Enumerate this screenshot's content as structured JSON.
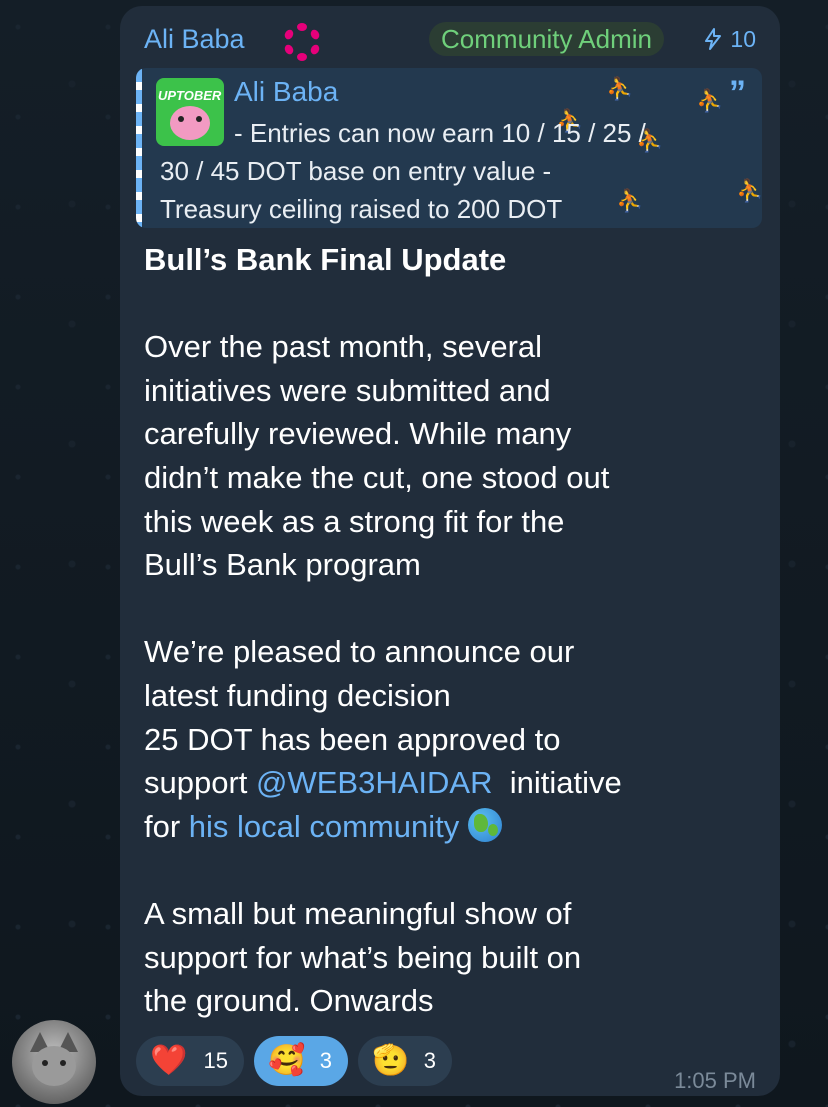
{
  "message": {
    "sender_name": "Ali Baba",
    "admin_badge": "Community Admin",
    "boost_count": "10",
    "reply": {
      "thumb_label": "UPTOBER",
      "name": "Ali Baba",
      "line1": "- Entries can now earn 10 / 15 / 25 /",
      "line2": "30 / 45 DOT base on entry value  -",
      "line3": "Treasury ceiling raised to 200 DOT"
    },
    "body": {
      "title": "Bull’s Bank Final Update",
      "p1": "Over the past month, several\ninitiatives were submitted and\ncarefully reviewed. While many\ndidn’t make the cut, one stood out\nthis week as a strong fit for the\nBull’s Bank program",
      "p2a": "We’re pleased to announce our\nlatest funding decision\n25 DOT has been approved to\nsupport ",
      "mention": "@WEB3HAIDAR",
      "p2b": "  initiative\nfor ",
      "link": "his local community",
      "p3": "A small but meaningful show of\nsupport for what’s being built on\nthe ground. Onwards"
    },
    "reactions": [
      {
        "emoji": "❤️",
        "count": "15",
        "selected": false
      },
      {
        "emoji": "🥰",
        "count": "3",
        "selected": true
      },
      {
        "emoji": "🫡",
        "count": "3",
        "selected": false
      }
    ],
    "timestamp": "1:05 PM"
  },
  "colors": {
    "bubble": "#212d3b",
    "link": "#6cb3f5",
    "admin_badge": "#6fd07b",
    "background": "#111a22"
  },
  "icons": [
    "polkadot-logo-icon",
    "boost-bolt-icon",
    "quote-icon",
    "globe-icon",
    "user-avatar"
  ]
}
